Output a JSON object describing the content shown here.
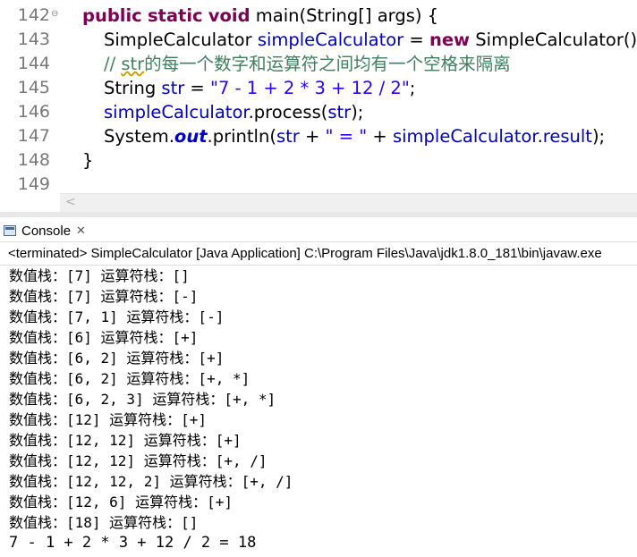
{
  "editor": {
    "line_numbers": [
      "142",
      "143",
      "144",
      "145",
      "146",
      "147",
      "148",
      "149"
    ],
    "code": {
      "l142": {
        "kw1": "public",
        "kw2": "static",
        "kw3": "void",
        "rest": " main(String[] args) {"
      },
      "l143": {
        "p1": "SimpleCalculator ",
        "field": "simpleCalculator",
        "p2": " = ",
        "kw": "new",
        "p3": " SimpleCalculator();"
      },
      "l144": {
        "c1": "// ",
        "c2": "str",
        "c3": "的每一个数字和运算符之间均有一个空格来隔离"
      },
      "l145": {
        "p1": "String ",
        "field": "str",
        "p2": " = ",
        "str": "\"7 - 1 + 2 * 3 + 12 / 2\"",
        "p3": ";"
      },
      "l146": {
        "field1": "simpleCalculator",
        "p1": ".process(",
        "field2": "str",
        "p2": ");"
      },
      "l147": {
        "p1": "System.",
        "sfield": "out",
        "p2": ".println(",
        "field1": "str",
        "p3": " + ",
        "str": "\" = \"",
        "p4": " + ",
        "field2": "simpleCalculator",
        "p5": ".",
        "field3": "result",
        "p6": ");"
      },
      "l148": {
        "p1": "}"
      },
      "l149": {
        "p1": ""
      }
    }
  },
  "console": {
    "tab_label": "Console",
    "close_glyph": "✕",
    "status": "<terminated> SimpleCalculator [Java Application] C:\\Program Files\\Java\\jdk1.8.0_181\\bin\\javaw.exe",
    "output_lines": [
      "数值栈：[7] 运算符栈：[]",
      "数值栈：[7] 运算符栈：[-]",
      "数值栈：[7, 1] 运算符栈：[-]",
      "数值栈：[6] 运算符栈：[+]",
      "数值栈：[6, 2] 运算符栈：[+]",
      "数值栈：[6, 2] 运算符栈：[+, *]",
      "数值栈：[6, 2, 3] 运算符栈：[+, *]",
      "数值栈：[12] 运算符栈：[+]",
      "数值栈：[12, 12] 运算符栈：[+]",
      "数值栈：[12, 12] 运算符栈：[+, /]",
      "数值栈：[12, 12, 2] 运算符栈：[+, /]",
      "数值栈：[12, 6] 运算符栈：[+]",
      "数值栈：[18] 运算符栈：[]",
      "7 - 1 + 2 * 3 + 12 / 2 = 18"
    ]
  },
  "colors": {
    "keyword": "#7f0055",
    "field": "#0000c0",
    "string": "#2a00ff",
    "comment": "#3f7f5f",
    "line_number": "#787878"
  },
  "icons": [
    "fold-collapse-icon",
    "console-icon",
    "close-icon",
    "scroll-left-icon"
  ]
}
